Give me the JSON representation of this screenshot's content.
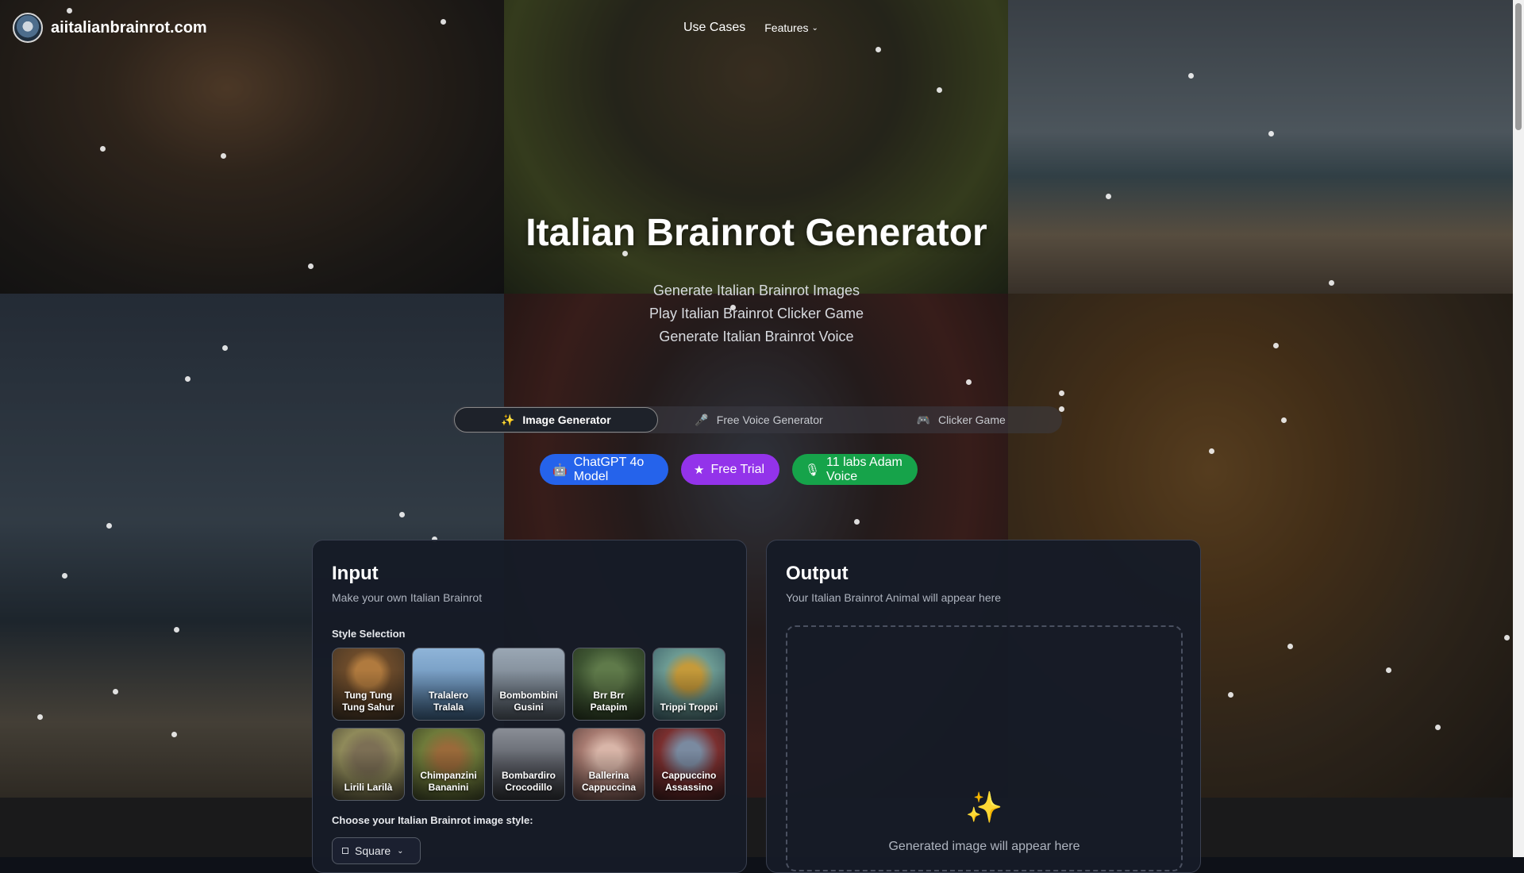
{
  "header": {
    "site_name": "aiitalianbrainrot.com",
    "nav": {
      "use_cases": "Use Cases",
      "features": "Features"
    }
  },
  "hero": {
    "title": "Italian Brainrot Generator",
    "lines": [
      "Generate Italian Brainrot Images",
      "Play Italian Brainrot Clicker Game",
      "Generate Italian Brainrot Voice"
    ]
  },
  "tabs": [
    {
      "label": "Image Generator",
      "icon": "sparkles-icon",
      "active": true
    },
    {
      "label": "Free Voice Generator",
      "icon": "microphone-icon",
      "active": false
    },
    {
      "label": "Clicker Game",
      "icon": "gamepad-icon",
      "active": false
    }
  ],
  "badges": [
    {
      "label": "ChatGPT 4o Model",
      "icon": "robot-icon",
      "color": "#2563eb"
    },
    {
      "label": "Free Trial",
      "icon": "star-icon",
      "color": "#9333ea"
    },
    {
      "label": "11 labs Adam Voice",
      "icon": "microphone-icon",
      "color": "#16a34a"
    }
  ],
  "input": {
    "title": "Input",
    "subtitle": "Make your own Italian Brainrot",
    "style_label": "Style Selection",
    "styles": [
      {
        "line1": "Tung Tung",
        "line2": "Tung Sahur"
      },
      {
        "line1": "Tralalero",
        "line2": "Tralala"
      },
      {
        "line1": "Bombombini",
        "line2": "Gusini"
      },
      {
        "line1": "Brr Brr",
        "line2": "Patapim"
      },
      {
        "line1": "Trippi Troppi",
        "line2": ""
      },
      {
        "line1": "Lirili Larilà",
        "line2": ""
      },
      {
        "line1": "Chimpanzini",
        "line2": "Bananini"
      },
      {
        "line1": "Bombardiro",
        "line2": "Crocodillo"
      },
      {
        "line1": "Ballerina",
        "line2": "Cappuccina"
      },
      {
        "line1": "Cappuccino",
        "line2": "Assassino"
      }
    ],
    "image_style_label": "Choose your Italian Brainrot image style:",
    "image_style_value": "Square"
  },
  "output": {
    "title": "Output",
    "subtitle": "Your Italian Brainrot Animal will appear here",
    "placeholder": "Generated image will appear here"
  }
}
